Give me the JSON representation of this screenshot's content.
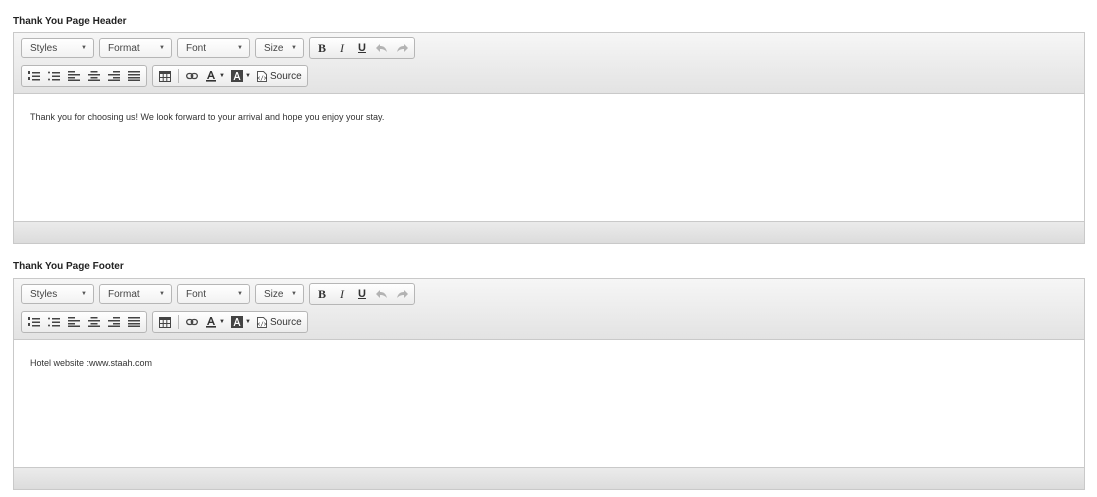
{
  "sections": [
    {
      "label": "Thank You Page Header",
      "combos": [
        "Styles",
        "Format",
        "Font",
        "Size"
      ],
      "source_label": "Source",
      "content": "Thank you for choosing us! We look forward to your arrival and hope you enjoy your stay."
    },
    {
      "label": "Thank You Page Footer",
      "combos": [
        "Styles",
        "Format",
        "Font",
        "Size"
      ],
      "source_label": "Source",
      "content": "Hotel website :www.staah.com"
    }
  ],
  "icons": {
    "bold": "B",
    "italic": "I",
    "underline": "U"
  }
}
